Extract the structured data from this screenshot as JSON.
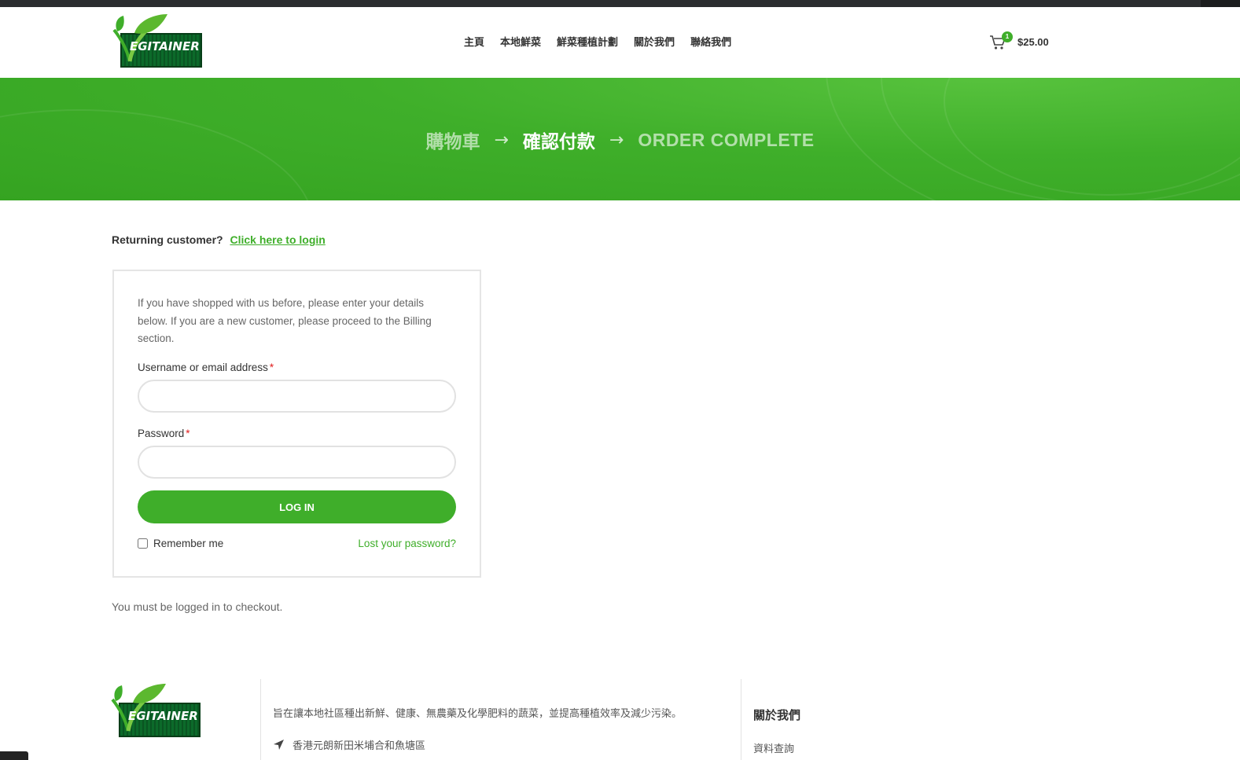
{
  "header": {
    "logo_text": "EGITAINER",
    "nav": [
      {
        "label": "主頁"
      },
      {
        "label": "本地鮮菜"
      },
      {
        "label": "鮮菜種植計劃"
      },
      {
        "label": "關於我們"
      },
      {
        "label": "聯絡我們"
      }
    ],
    "cart": {
      "count": "1",
      "total": "$25.00"
    }
  },
  "hero": {
    "step1": "購物車",
    "step2": "確認付款",
    "step3": "ORDER COMPLETE",
    "arrow": "→"
  },
  "checkout": {
    "returning_label": "Returning customer?",
    "login_link": "Click here to login",
    "intro": "If you have shopped with us before, please enter your details below. If you are a new customer, please proceed to the Billing section.",
    "username_label": "Username or email address",
    "password_label": "Password",
    "required_mark": "*",
    "username_value": "",
    "password_value": "",
    "login_button": "LOG IN",
    "remember_label": "Remember me",
    "lost_password": "Lost your password?",
    "must_login": "You must be logged in to checkout."
  },
  "footer": {
    "logo_text": "EGITAINER",
    "description": "旨在讓本地社區種出新鮮、健康、無農藥及化學肥料的蔬菜，並提高種植效率及減少污染。",
    "address": "香港元朗新田米埔合和魚塘區",
    "about_title": "關於我們",
    "about_link": "資料查詢"
  },
  "colors": {
    "accent": "#3fae2a",
    "required": "#e01a1a",
    "text_dark": "#333333",
    "text_muted": "#666666"
  }
}
